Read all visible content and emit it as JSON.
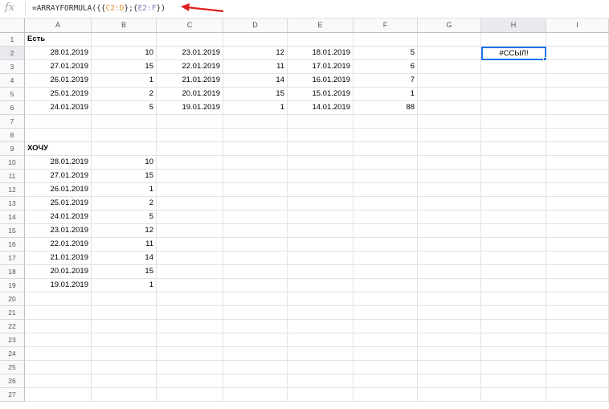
{
  "formula_bar": {
    "fx_label": "fx",
    "formula_prefix": "=ARRAYFORMULA({{",
    "ref1": "C2:D",
    "sep": "};{",
    "ref2": "E2:F",
    "formula_suffix": "})"
  },
  "columns": [
    "A",
    "B",
    "C",
    "D",
    "E",
    "F",
    "G",
    "H",
    "I"
  ],
  "active_cell": "H2",
  "rows": [
    {
      "num": "1",
      "cells": {
        "A": "Есть"
      }
    },
    {
      "num": "2",
      "cells": {
        "A": "28.01.2019",
        "B": "10",
        "C": "23.01.2019",
        "D": "12",
        "E": "18.01.2019",
        "F": "5",
        "H": "#ССЫЛ!"
      }
    },
    {
      "num": "3",
      "cells": {
        "A": "27.01.2019",
        "B": "15",
        "C": "22.01.2019",
        "D": "11",
        "E": "17.01.2019",
        "F": "6"
      }
    },
    {
      "num": "4",
      "cells": {
        "A": "26.01.2019",
        "B": "1",
        "C": "21.01.2019",
        "D": "14",
        "E": "16.01.2019",
        "F": "7"
      }
    },
    {
      "num": "5",
      "cells": {
        "A": "25.01.2019",
        "B": "2",
        "C": "20.01.2019",
        "D": "15",
        "E": "15.01.2019",
        "F": "1"
      }
    },
    {
      "num": "6",
      "cells": {
        "A": "24.01.2019",
        "B": "5",
        "C": "19.01.2019",
        "D": "1",
        "E": "14.01.2019",
        "F": "88"
      }
    },
    {
      "num": "7",
      "cells": {}
    },
    {
      "num": "8",
      "cells": {}
    },
    {
      "num": "9",
      "cells": {
        "A": "ХОЧУ"
      }
    },
    {
      "num": "10",
      "cells": {
        "A": "28.01.2019",
        "B": "10"
      }
    },
    {
      "num": "11",
      "cells": {
        "A": "27.01.2019",
        "B": "15"
      }
    },
    {
      "num": "12",
      "cells": {
        "A": "26.01.2019",
        "B": "1"
      }
    },
    {
      "num": "13",
      "cells": {
        "A": "25.01.2019",
        "B": "2"
      }
    },
    {
      "num": "14",
      "cells": {
        "A": "24.01.2019",
        "B": "5"
      }
    },
    {
      "num": "15",
      "cells": {
        "A": "23.01.2019",
        "B": "12"
      }
    },
    {
      "num": "16",
      "cells": {
        "A": "22.01.2019",
        "B": "11"
      }
    },
    {
      "num": "17",
      "cells": {
        "A": "21.01.2019",
        "B": "14"
      }
    },
    {
      "num": "18",
      "cells": {
        "A": "20.01.2019",
        "B": "15"
      }
    },
    {
      "num": "19",
      "cells": {
        "A": "19.01.2019",
        "B": "1"
      }
    },
    {
      "num": "20",
      "cells": {}
    },
    {
      "num": "21",
      "cells": {}
    },
    {
      "num": "22",
      "cells": {}
    },
    {
      "num": "23",
      "cells": {}
    },
    {
      "num": "24",
      "cells": {}
    },
    {
      "num": "25",
      "cells": {}
    },
    {
      "num": "26",
      "cells": {}
    },
    {
      "num": "27",
      "cells": {}
    }
  ],
  "colors": {
    "active_border": "#1a73e8",
    "annotation_arrow": "#e02020",
    "ref1_color": "#e69138",
    "ref2_color": "#8e7cc3"
  },
  "icons": {
    "fx": "function-icon",
    "arrow": "red-annotation-arrow"
  }
}
